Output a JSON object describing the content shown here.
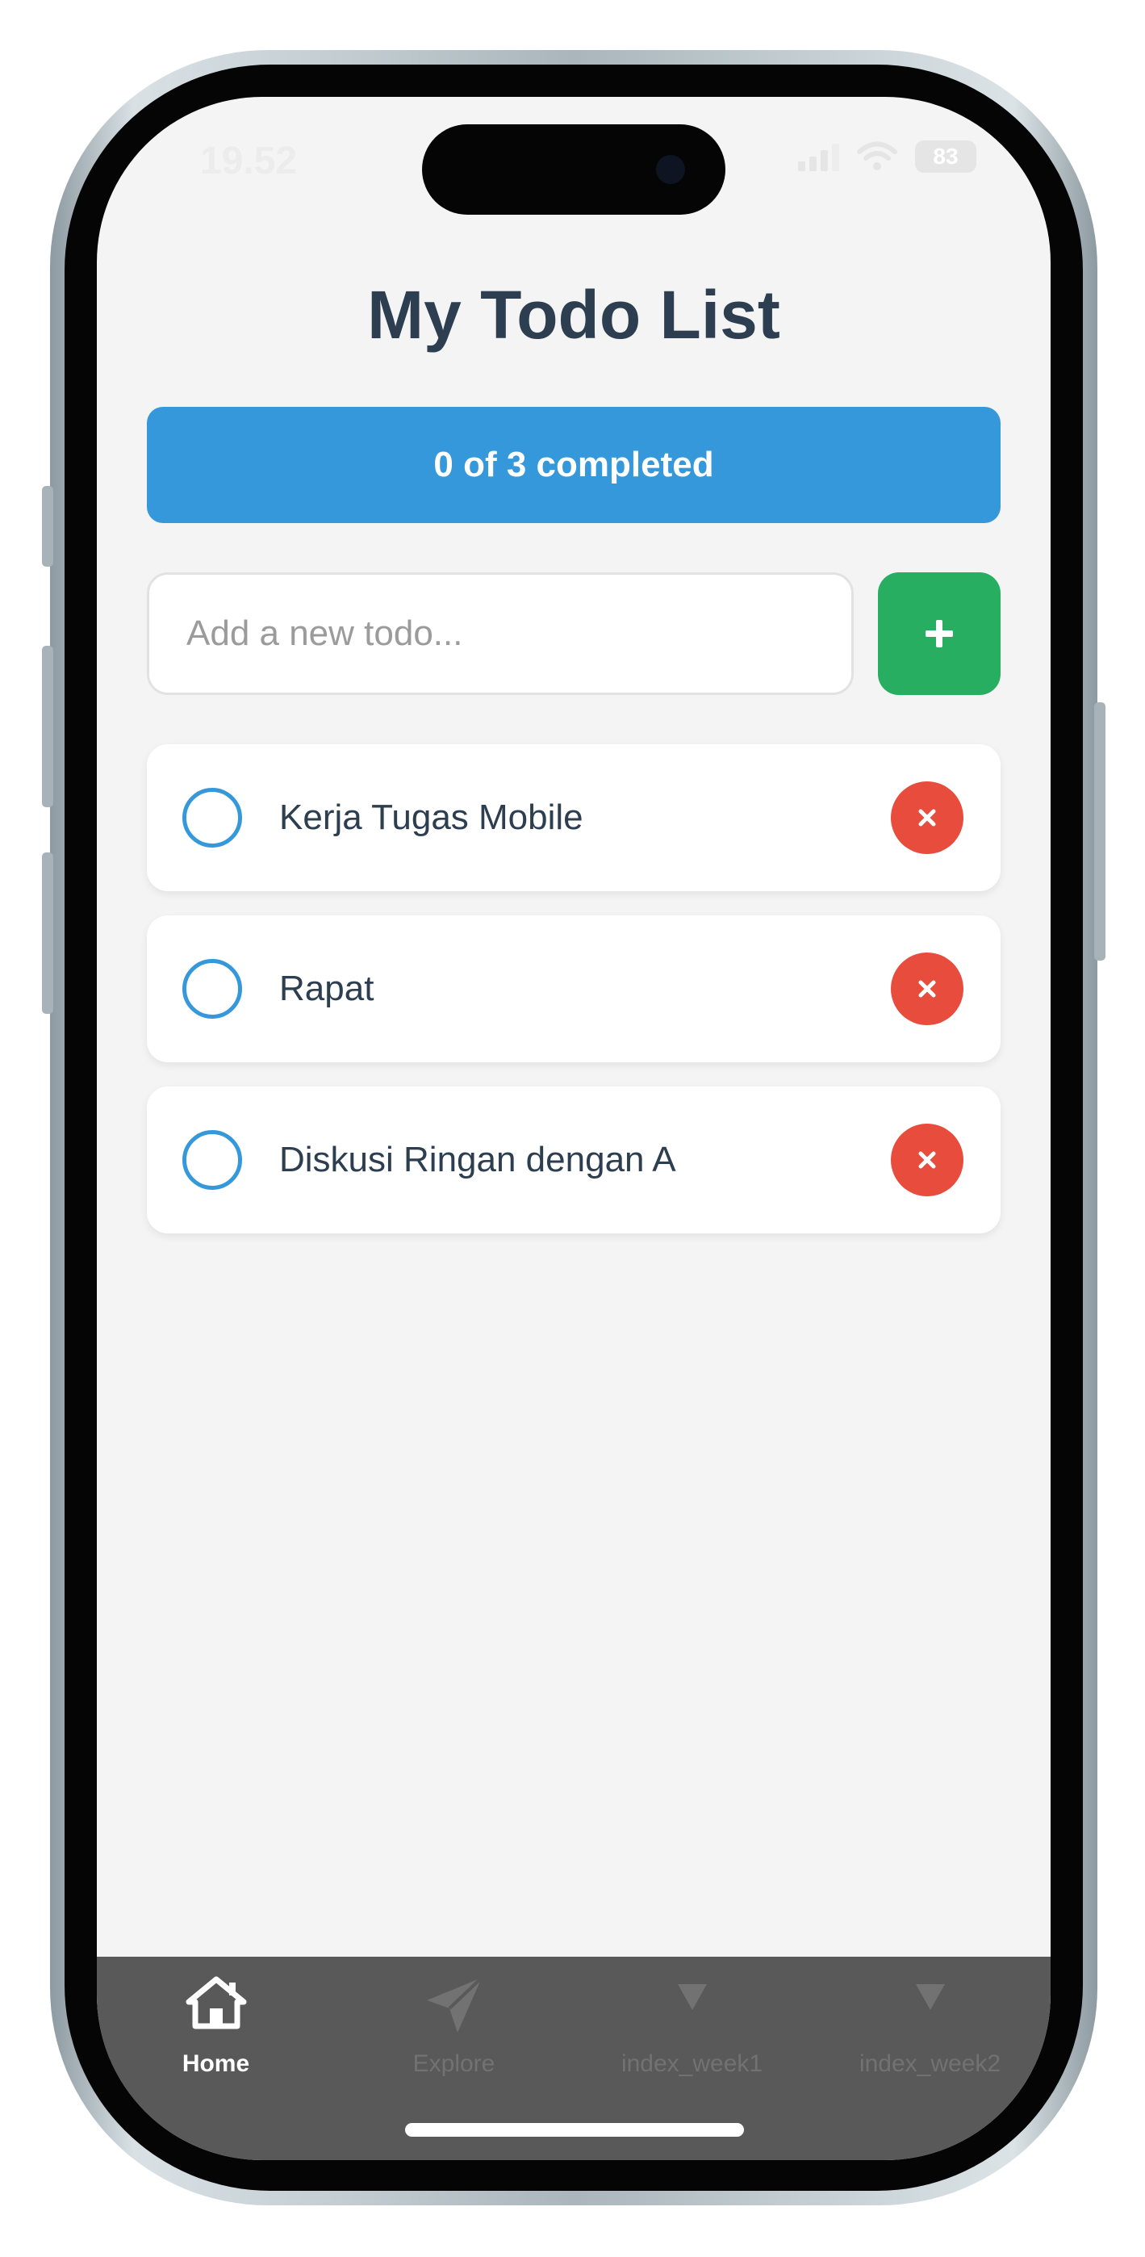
{
  "status_bar": {
    "time": "19.52",
    "battery": "83"
  },
  "header": {
    "title": "My Todo List"
  },
  "progress": {
    "text": "0 of 3 completed",
    "completed": 0,
    "total": 3
  },
  "add_todo": {
    "placeholder": "Add a new todo...",
    "value": "",
    "button_icon": "plus-icon"
  },
  "todos": [
    {
      "text": "Kerja Tugas Mobile",
      "completed": false
    },
    {
      "text": "Rapat",
      "completed": false
    },
    {
      "text": "Diskusi Ringan dengan A",
      "completed": false
    }
  ],
  "tab_bar": {
    "tabs": [
      {
        "label": "Home",
        "icon": "home-icon",
        "active": true
      },
      {
        "label": "Explore",
        "icon": "paper-plane-icon",
        "active": false
      },
      {
        "label": "index_week1",
        "icon": "triangle-down-icon",
        "active": false
      },
      {
        "label": "index_week2",
        "icon": "triangle-down-icon",
        "active": false
      }
    ]
  },
  "colors": {
    "accent_blue": "#3498db",
    "add_green": "#27ae60",
    "delete_red": "#e74c3c",
    "title_text": "#2c3e50",
    "tab_bar_bg": "#595959"
  }
}
